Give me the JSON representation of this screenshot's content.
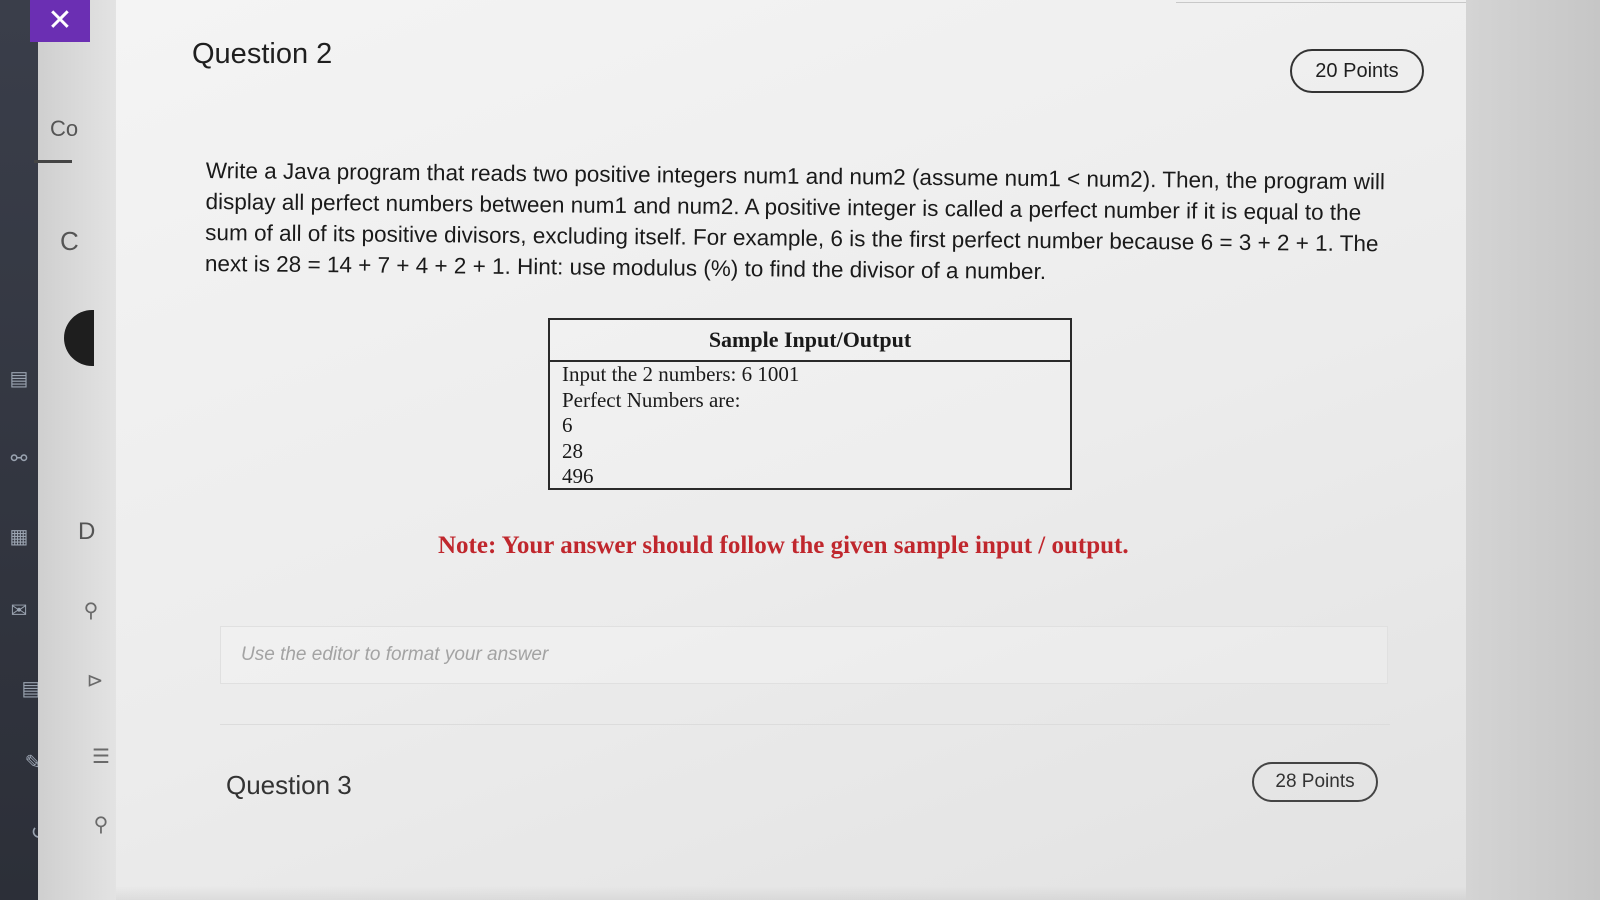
{
  "close_icon": "close-icon",
  "left_rail": {
    "icons": [
      "form-icon",
      "users-icon",
      "calendar-icon",
      "mail-icon",
      "document-icon",
      "edit-icon",
      "sign-out-icon"
    ]
  },
  "second_rail": {
    "letters": [
      "Co",
      "C",
      "D"
    ],
    "icons": [
      "person-icon",
      "expand-icon",
      "list-icon",
      "people-icon"
    ]
  },
  "question2": {
    "title": "Question 2",
    "points": "20 Points",
    "prompt": "Write a Java program  that reads two positive integers num1 and num2 (assume num1 < num2). Then, the program will display all perfect numbers between num1 and num2. A positive integer is called a perfect number if it is equal to the sum of all of its positive divisors, excluding itself. For example, 6 is the first perfect number because 6 = 3 + 2 + 1. The next is 28 = 14 + 7 + 4 + 2 + 1. Hint: use modulus (%) to find the divisor of a number.",
    "sample": {
      "heading": "Sample Input/Output",
      "lines": [
        "Input the 2 numbers: 6  1001",
        "Perfect Numbers are:",
        "6",
        "28",
        "496"
      ]
    },
    "note": "Note: Your answer should follow the given sample input / output.",
    "editor_placeholder": "Use the editor to format your answer"
  },
  "question3": {
    "title": "Question 3",
    "points": "28 Points"
  },
  "colors": {
    "accent": "#6b2fb3",
    "note_red": "#c0272d",
    "rail_dark": "#2c2f38"
  }
}
